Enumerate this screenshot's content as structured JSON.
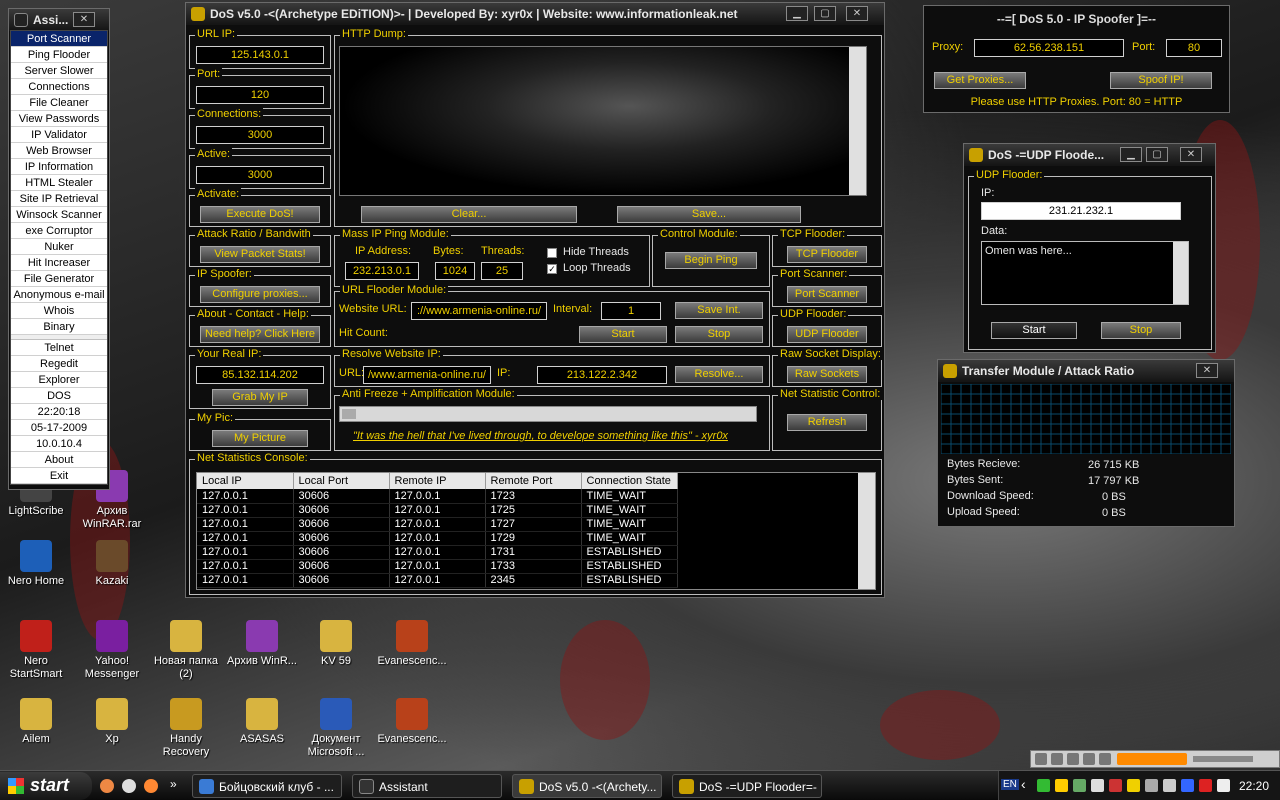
{
  "assistant": {
    "title": "Assi...",
    "menu_top": [
      "Port Scanner",
      "Ping Flooder",
      "Server Slower",
      "Connections",
      "File Cleaner",
      "View Passwords",
      "IP Validator",
      "Web Browser",
      "IP Information",
      "HTML Stealer",
      "Site IP Retrieval",
      "Winsock Scanner",
      "exe Corruptor",
      "Nuker",
      "Hit Increaser",
      "File Generator",
      "Anonymous e-mail",
      "Whois",
      "Binary"
    ],
    "menu_mid": [
      "Telnet",
      "Regedit",
      "Explorer",
      "DOS"
    ],
    "time": "22:20:18",
    "date": "05-17-2009",
    "ip": "10.0.10.4",
    "about": "About",
    "exit": "Exit"
  },
  "dos": {
    "title": "DoS v5.0 -<(Archetype EDiTION)>- | Developed By: xyr0x | Website: www.informationleak.net",
    "url_ip_label": "URL IP:",
    "url_ip": "125.143.0.1",
    "port_label": "Port:",
    "port": "120",
    "connections_label": "Connections:",
    "connections": "3000",
    "active_label": "Active:",
    "active": "3000",
    "activate_label": "Activate:",
    "execute": "Execute DoS!",
    "http_dump_label": "HTTP Dump:",
    "clear": "Clear...",
    "save": "Save...",
    "attack_label": "Attack Ratio / Bandwith",
    "view_stats": "View Packet Stats!",
    "spoofer_label": "IP Spoofer:",
    "configure": "Configure proxies...",
    "about_label": "About - Contact - Help:",
    "help": "Need help? Click Here",
    "real_ip_label": "Your Real IP:",
    "real_ip": "85.132.114.202",
    "grab": "Grab My IP",
    "pic_label": "My Pic:",
    "pic": "My Picture",
    "mass_label": "Mass IP Ping Module:",
    "ip_addr_label": "IP Address:",
    "ip_addr": "232.213.0.1",
    "bytes_label": "Bytes:",
    "bytes": "1024",
    "threads_label": "Threads:",
    "threads": "25",
    "hide_threads": "Hide Threads",
    "loop_threads": "Loop Threads",
    "loop_check": "✓",
    "control_label": "Control Module:",
    "begin_ping": "Begin Ping",
    "tcp_label": "TCP Flooder:",
    "tcp": "TCP Flooder",
    "pscan_label": "Port Scanner:",
    "pscan": "Port Scanner",
    "udp_label": "UDP Flooder:",
    "udp": "UDP Flooder",
    "raw_label": "Raw Socket Display:",
    "raw": "Raw Sockets",
    "net_label": "Net Statistic Control:",
    "refresh": "Refresh",
    "urlf_label": "URL Flooder Module:",
    "website_label": "Website URL:",
    "website": "://www.armenia-online.ru/",
    "interval_label": "Interval:",
    "interval": "1",
    "save_int": "Save Int.",
    "hit_label": "Hit Count:",
    "start": "Start",
    "stop": "Stop",
    "resolve_label": "Resolve Website IP:",
    "url_label": "URL:",
    "url": "/www.armenia-online.ru/",
    "ip_label": "IP:",
    "resolved_ip": "213.122.2.342",
    "resolve": "Resolve...",
    "anti_label": "Anti Freeze + Amplification Module:",
    "quote": "\"It was the hell that I've lived through, to develope something like this\" - xyr0x",
    "console_label": "Net Statistics Console:",
    "columns": [
      "Local IP",
      "Local Port",
      "Remote IP",
      "Remote Port",
      "Connection State"
    ],
    "rows": [
      [
        "127.0.0.1",
        "30606",
        "127.0.0.1",
        "1723",
        "TIME_WAIT"
      ],
      [
        "127.0.0.1",
        "30606",
        "127.0.0.1",
        "1725",
        "TIME_WAIT"
      ],
      [
        "127.0.0.1",
        "30606",
        "127.0.0.1",
        "1727",
        "TIME_WAIT"
      ],
      [
        "127.0.0.1",
        "30606",
        "127.0.0.1",
        "1729",
        "TIME_WAIT"
      ],
      [
        "127.0.0.1",
        "30606",
        "127.0.0.1",
        "1731",
        "ESTABLISHED"
      ],
      [
        "127.0.0.1",
        "30606",
        "127.0.0.1",
        "1733",
        "ESTABLISHED"
      ],
      [
        "127.0.0.1",
        "30606",
        "127.0.0.1",
        "2345",
        "ESTABLISHED"
      ]
    ]
  },
  "spoof": {
    "title": "--=[ DoS 5.0 - IP Spoofer ]=--",
    "proxy_label": "Proxy:",
    "proxy": "62.56.238.151",
    "port_label": "Port:",
    "port": "80",
    "get": "Get Proxies...",
    "spoof": "Spoof IP!",
    "note": "Please use HTTP Proxies. Port: 80 = HTTP"
  },
  "udp": {
    "title": "DoS -=UDP Floode...",
    "group": "UDP Flooder:",
    "ip_label": "IP:",
    "ip": "231.21.232.1",
    "data_label": "Data:",
    "data": "Omen was here...",
    "start": "Start",
    "stop": "Stop"
  },
  "transfer": {
    "title": "Transfer Module / Attack Ratio",
    "recv_label": "Bytes Recieve:",
    "recv": "26 715 KB",
    "sent_label": "Bytes Sent:",
    "sent": "17 797 KB",
    "dl_label": "Download Speed:",
    "dl": "0 BS",
    "ul_label": "Upload Speed:",
    "ul": "0 BS"
  },
  "desktop": [
    {
      "label": "Nero Home",
      "color": "#1d5fb8"
    },
    {
      "label": "Kazaki",
      "color": "#6a4a2a"
    },
    {
      "label": "Nero StartSmart",
      "color": "#c0201a"
    },
    {
      "label": "Yahoo! Messenger",
      "color": "#7a1fa0"
    },
    {
      "label": "Новая папка (2)",
      "color": "#d8b440"
    },
    {
      "label": "Архив WinR...",
      "color": "#8a3ab0"
    },
    {
      "label": "KV 59",
      "color": "#d8b440"
    },
    {
      "label": "Evanescenc...",
      "color": "#b8411a"
    },
    {
      "label": "Ailem",
      "color": "#d8b440"
    },
    {
      "label": "Xp",
      "color": "#d8b440"
    },
    {
      "label": "Handy Recovery",
      "color": "#c89a20"
    },
    {
      "label": "ASASAS",
      "color": "#d8b440"
    },
    {
      "label": "Документ Microsoft ...",
      "color": "#2a5ab8"
    },
    {
      "label": "Evanescenc...",
      "color": "#b8411a"
    },
    {
      "label": "LightScribe",
      "color": "#444"
    },
    {
      "label": "Архив WinRAR.rar",
      "color": "#8a3ab0"
    }
  ],
  "taskbar": {
    "start": "start",
    "tasks": [
      "Бойцовский клуб - ...",
      "Assistant",
      "DoS v5.0 -<(Archety...",
      "DoS -=UDP Flooder=-"
    ],
    "lang": "EN",
    "time": "22:20"
  },
  "colors": {
    "accent": "#f0d000",
    "window": "#0d0d0d",
    "grid": "#0a4a6a"
  }
}
